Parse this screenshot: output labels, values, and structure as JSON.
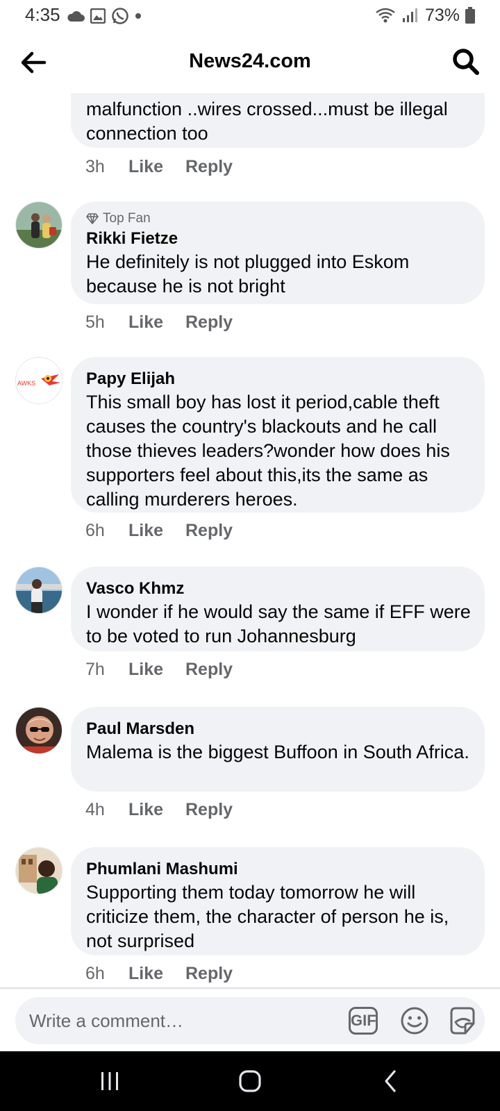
{
  "status_bar": {
    "time": "4:35",
    "battery": "73%",
    "icons": [
      "cloud-icon",
      "gallery-icon",
      "whatsapp-icon",
      "dot-icon",
      "wifi-icon",
      "signal-icon",
      "battery-icon"
    ]
  },
  "header": {
    "title": "News24.com"
  },
  "comments": [
    {
      "author": "",
      "text": "malfunction ..wires crossed...must be illegal connection too",
      "time": "3h",
      "like_label": "Like",
      "reply_label": "Reply"
    },
    {
      "badge": "Top Fan",
      "author": "Rikki Fietze",
      "text": "He definitely is not plugged into Eskom because he is not bright",
      "time": "5h",
      "like_label": "Like",
      "reply_label": "Reply"
    },
    {
      "author": "Papy Elijah",
      "text": "This small boy has lost it period,cable theft causes the country's blackouts and he call those thieves leaders?wonder how does his supporters feel about this,its the same as calling murderers heroes.",
      "time": "6h",
      "like_label": "Like",
      "reply_label": "Reply",
      "avatar_text": "AWKS"
    },
    {
      "author": "Vasco Khmz",
      "text": "I wonder if he would say the same if  EFF were to be voted to run Johannesburg",
      "time": "7h",
      "like_label": "Like",
      "reply_label": "Reply"
    },
    {
      "author": "Paul Marsden",
      "text": "Malema is the biggest Buffoon in South Africa.",
      "time": "4h",
      "like_label": "Like",
      "reply_label": "Reply"
    },
    {
      "author": "Phumlani Mashumi",
      "text": "Supporting them today tomorrow he will criticize them, the character of person he is, not surprised",
      "time": "6h",
      "like_label": "Like",
      "reply_label": "Reply"
    }
  ],
  "composer": {
    "placeholder": "Write a comment…",
    "gif_label": "GIF"
  },
  "colors": {
    "bubble": "#f0f2f5",
    "meta_text": "#65676b",
    "text": "#050505",
    "navbar": "#000000"
  }
}
